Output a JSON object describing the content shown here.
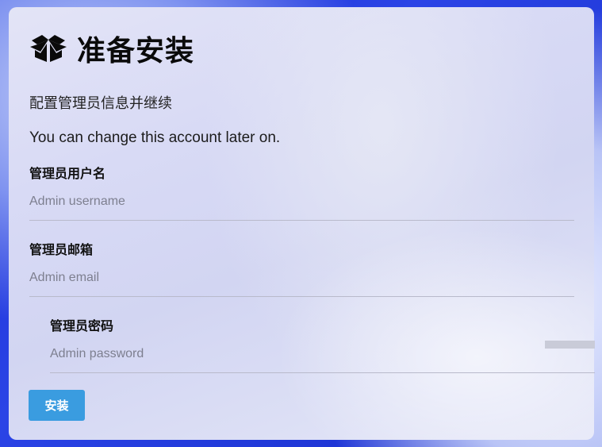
{
  "page": {
    "title": "准备安装",
    "subtitle": "配置管理员信息并继续",
    "note": "You can change this account later on."
  },
  "form": {
    "username": {
      "label": "管理员用户名",
      "placeholder": "Admin username",
      "value": ""
    },
    "email": {
      "label": "管理员邮箱",
      "placeholder": "Admin email",
      "value": ""
    },
    "password": {
      "label": "管理员密码",
      "placeholder": "Admin password",
      "value": ""
    },
    "submit_label": "安装"
  },
  "icons": {
    "title_icon": "box-open-icon"
  },
  "colors": {
    "accent": "#3a9ce0",
    "background": "#1b2fd0"
  }
}
